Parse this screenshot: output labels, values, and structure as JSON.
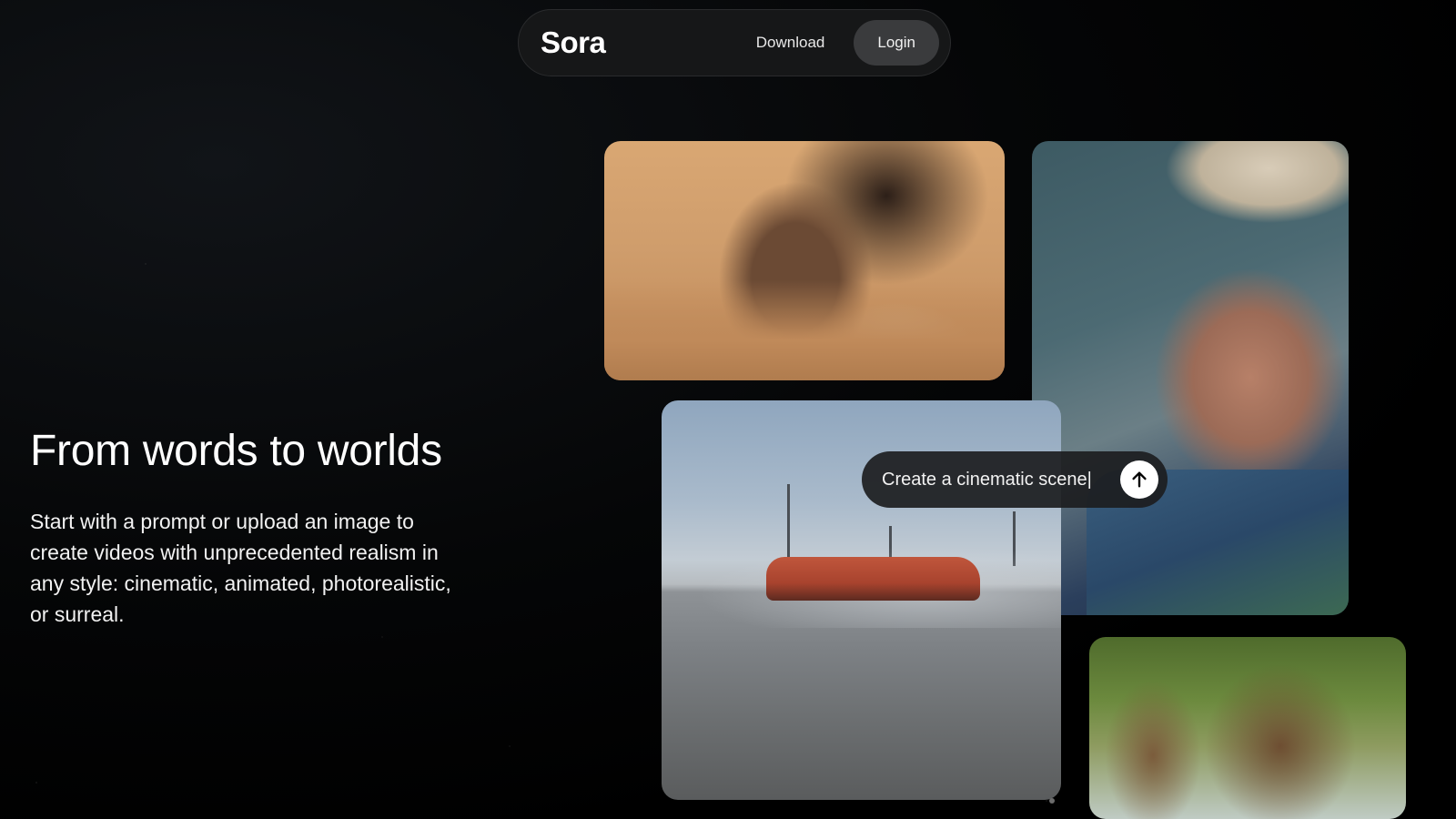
{
  "nav": {
    "brand": "Sora",
    "download_label": "Download",
    "login_label": "Login"
  },
  "hero": {
    "title": "From words to worlds",
    "description": "Start with a prompt or upload an image to create videos with unprecedented realism in any style: cinematic, animated, photorealistic, or surreal."
  },
  "prompt": {
    "text": "Create a cinematic scene|",
    "send_icon": "arrow-up-icon"
  },
  "colors": {
    "background": "#000000",
    "nav_bg": "#161718",
    "login_bg": "#3a3b3d",
    "prompt_bg": "#1c1d1f"
  }
}
